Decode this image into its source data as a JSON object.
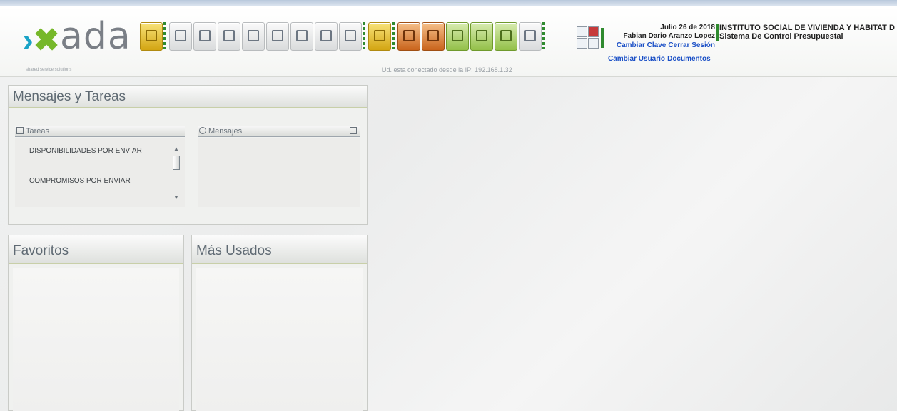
{
  "brand": {
    "name": "ada",
    "tagline": "shared service solutions"
  },
  "toolbar": {
    "buttons": [
      {
        "name": "folder-icon",
        "style": "y"
      },
      {
        "name": "new-document-icon",
        "style": "g"
      },
      {
        "name": "save-icon",
        "style": "g"
      },
      {
        "name": "document-icon",
        "style": "g"
      },
      {
        "name": "undo-icon",
        "style": "g"
      },
      {
        "name": "print-icon",
        "style": "g"
      },
      {
        "name": "search-icon",
        "style": "g"
      },
      {
        "name": "report-icon",
        "style": "g"
      },
      {
        "name": "delete-icon",
        "style": "g"
      },
      {
        "name": "lock-icon",
        "style": "y"
      },
      {
        "name": "exit-icon",
        "style": "o"
      },
      {
        "name": "home-icon",
        "style": "o"
      },
      {
        "name": "grid-icon",
        "style": "gn"
      },
      {
        "name": "modules-icon",
        "style": "gn"
      },
      {
        "name": "settings-icon",
        "style": "gn"
      },
      {
        "name": "calendar-icon",
        "style": "g"
      }
    ]
  },
  "connection_text": "Ud. esta conectado desde la IP: 192.168.1.32",
  "user": {
    "date": "Julio 26 de 2018",
    "name": "Fabian Dario Aranzo Lopez",
    "change_password": "Cambiar Clave",
    "logout": "Cerrar Sesión",
    "change_user": "Cambiar Usuario",
    "documents": "Documentos"
  },
  "org": {
    "name": "INSTITUTO SOCIAL DE VIVIENDA Y HABITAT D",
    "system": "Sistema De Control Presupuestal"
  },
  "messages_panel": {
    "title": "Mensajes y Tareas",
    "tasks_header": "Tareas",
    "messages_header": "Mensajes",
    "tasks": [
      "DISPONIBILIDADES POR ENVIAR",
      "COMPROMISOS POR ENVIAR"
    ]
  },
  "favorites_panel": {
    "title": "Favoritos"
  },
  "most_used_panel": {
    "title": "Más Usados"
  },
  "colors": {
    "accent_green": "#2e8a2e",
    "link_blue": "#1a4fc6",
    "logo_cyan": "#1aa3c6"
  }
}
